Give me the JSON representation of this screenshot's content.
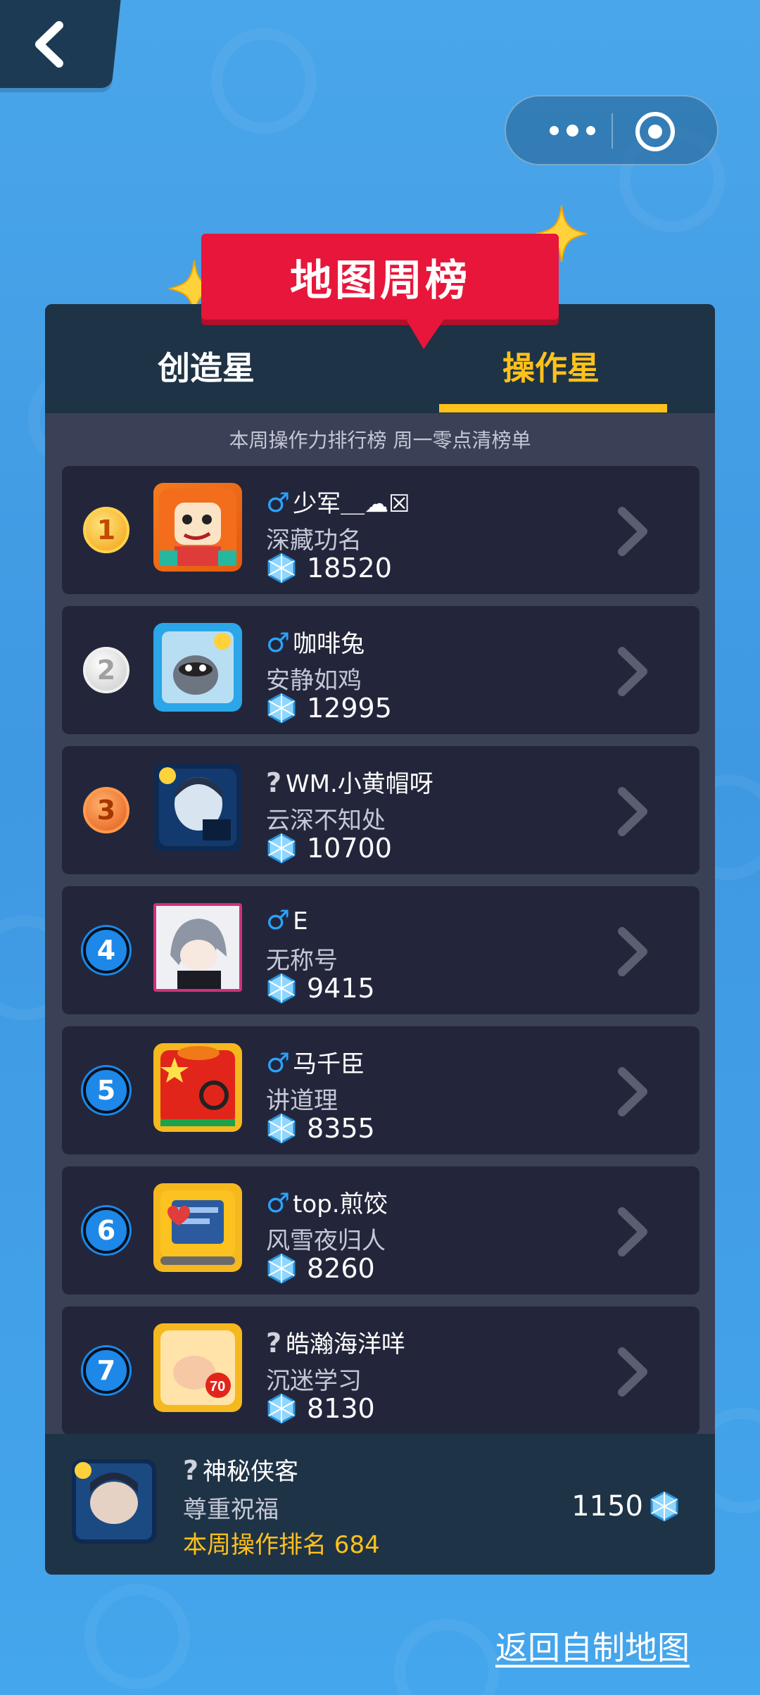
{
  "header": {
    "title": "地图周榜",
    "back_icon": "chevron-left-icon",
    "capsule_more_icon": "more-dots-icon",
    "capsule_close_icon": "target-circle-icon"
  },
  "tabs": [
    {
      "label": "创造星",
      "active": false
    },
    {
      "label": "操作星",
      "active": true
    }
  ],
  "subtitle": "本周操作力排行榜 周一零点清榜单",
  "colors": {
    "accent": "#ffc11a",
    "banner": "#e8163a",
    "gender_male": "#2aa3ff",
    "row_bg": "#23263a"
  },
  "rows": [
    {
      "rank": "1",
      "gender": "♂",
      "name": "少军＿☁☒",
      "title": "深藏功名",
      "score": "18520"
    },
    {
      "rank": "2",
      "gender": "♂",
      "name": "咖啡兔",
      "title": "安静如鸡",
      "score": "12995"
    },
    {
      "rank": "3",
      "gender": "?",
      "name": "WM.小黄帽呀",
      "title": "云深不知处",
      "score": "10700"
    },
    {
      "rank": "4",
      "gender": "♂",
      "name": "E",
      "title": "无称号",
      "score": "9415"
    },
    {
      "rank": "5",
      "gender": "♂",
      "name": "马千臣",
      "title": "讲道理",
      "score": "8355"
    },
    {
      "rank": "6",
      "gender": "♂",
      "name": "top.煎饺",
      "title": "风雪夜归人",
      "score": "8260"
    },
    {
      "rank": "7",
      "gender": "?",
      "name": "皓瀚海洋咩",
      "title": "沉迷学习",
      "score": "8130"
    }
  ],
  "self": {
    "gender": "?",
    "name": "神秘侠客",
    "title": "尊重祝福",
    "rank_text": "本周操作排名 684",
    "score": "1150"
  },
  "footer_link": "返回自制地图"
}
